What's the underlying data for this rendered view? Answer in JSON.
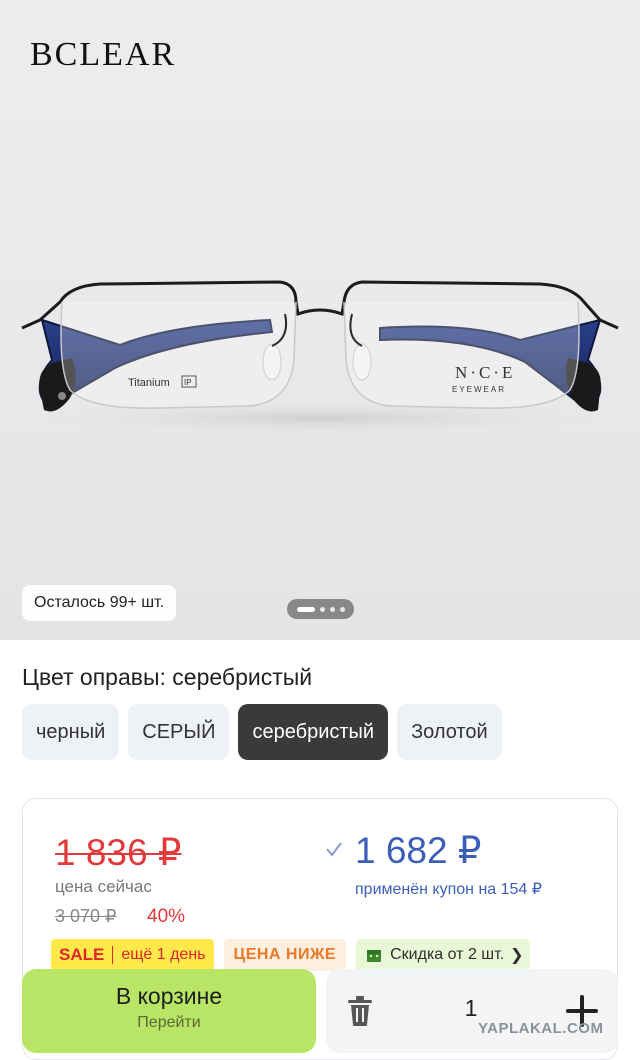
{
  "gallery": {
    "brand": "BCLEAR",
    "temple_print": "Titanium",
    "temple_badge": "IP",
    "lens_logo": "N·C·E",
    "lens_logo_sub": "EYEWEAR",
    "stock_badge": "Осталось 99+ шт.",
    "slide_count": 4,
    "active_slide": 1
  },
  "color_selector": {
    "title": "Цвет оправы: серебристый",
    "options": [
      {
        "label": "черный",
        "selected": false
      },
      {
        "label": "СЕРЫЙ",
        "selected": false
      },
      {
        "label": "серебристый",
        "selected": true
      },
      {
        "label": "Золотой",
        "selected": false
      }
    ]
  },
  "price": {
    "old_price": "1 836 ₽",
    "now_label": "цена сейчас",
    "original_price": "3 070 ₽",
    "discount": "40%",
    "coupon_price": "1 682 ₽",
    "coupon_note": "применён купон на 154 ₽"
  },
  "tags": {
    "sale_word": "SALE",
    "sale_days": "ещё 1 день",
    "lower_price": "ЦЕНА НИЖЕ",
    "multi_discount": "Скидка от 2 шт.",
    "multi_chevron": "❯"
  },
  "actions": {
    "cart_label": "В корзине",
    "cart_sublabel": "Перейти",
    "quantity": "1"
  },
  "watermark": "YAPLAKAL.COM",
  "colors": {
    "accent_green": "#b8e566",
    "price_red": "#e03a3a",
    "coupon_blue": "#3b5fb8",
    "selected_chip": "#3a3a3a",
    "sale_yellow": "#ffe94a"
  }
}
